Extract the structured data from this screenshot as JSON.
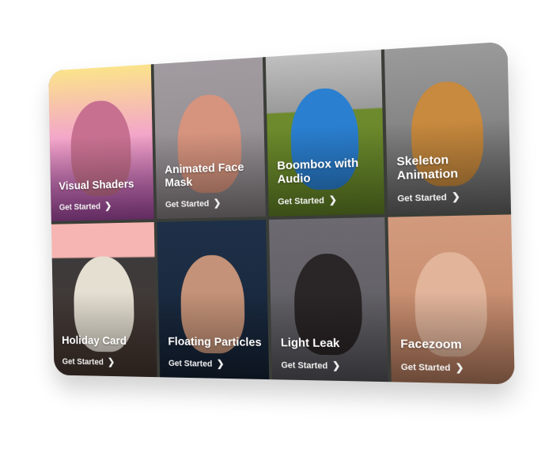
{
  "cta_label": "Get Started",
  "chevron_icon": "chevron-right-icon",
  "tiles": [
    {
      "title": "Visual Shaders",
      "bg": "linear-gradient(#fbe38b,#f3a6c9 45%,#b14fb0)",
      "fig": "#c77090"
    },
    {
      "title": "Animated Face Mask",
      "bg": "linear-gradient(#a19ba0,#8e878a)",
      "fig": "#d6947e"
    },
    {
      "title": "Boombox with Audio",
      "bg": "linear-gradient(#bfbfbf 0%,#9a9a9a 35%,#6d8a2c 36%,#6a8d2a)",
      "fig": "#2a7fd0"
    },
    {
      "title": "Skeleton Animation",
      "bg": "linear-gradient(#9a9a9a,#6e6e6e)",
      "fig": "#c88a3e"
    },
    {
      "title": "Holiday Card",
      "bg": "linear-gradient(#f6b5b2 0%,#f6b5b2 22%,#3c3a3a 23%,#4a3a33)",
      "fig": "#e5dfd2"
    },
    {
      "title": "Floating Particles",
      "bg": "linear-gradient(#1e3048,#162438)",
      "fig": "#c49278"
    },
    {
      "title": "Light Leak",
      "bg": "linear-gradient(#6c6a70,#5b5a60)",
      "fig": "#2a2526"
    },
    {
      "title": "Facezoom",
      "bg": "linear-gradient(#d29a7d,#c28566)",
      "fig": "#e2b59b"
    }
  ]
}
